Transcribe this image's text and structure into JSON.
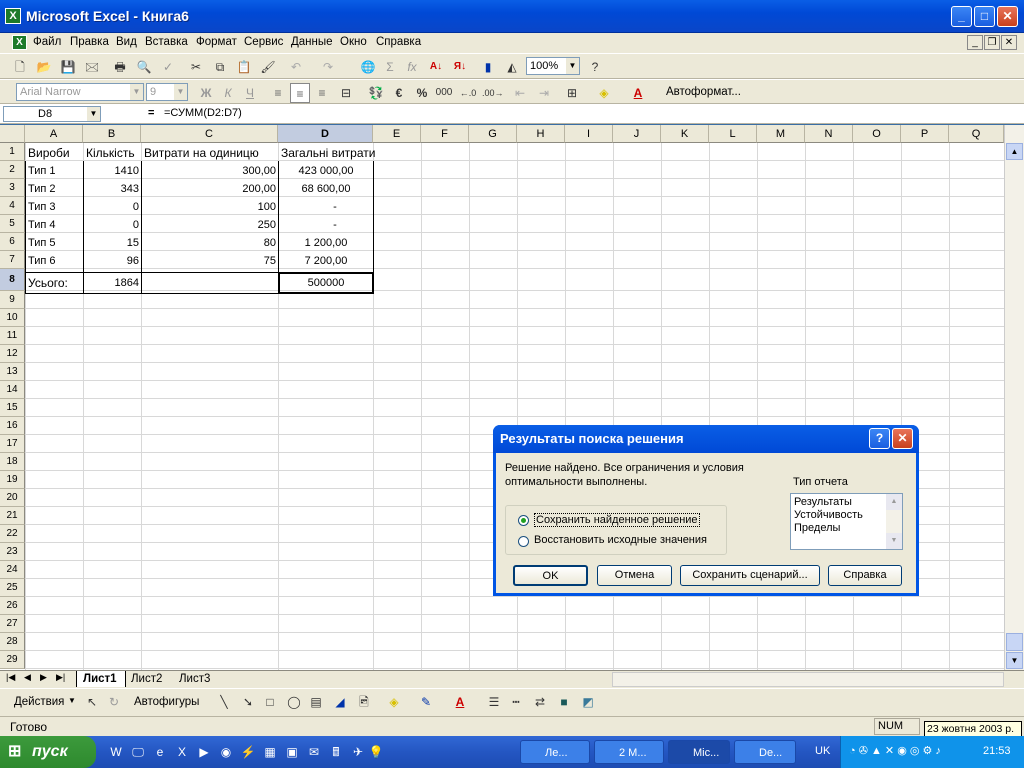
{
  "window": {
    "title": "Microsoft Excel - Книга6"
  },
  "menu": [
    "Файл",
    "Правка",
    "Вид",
    "Вставка",
    "Формат",
    "Сервис",
    "Данные",
    "Окно",
    "Справка"
  ],
  "toolbar": {
    "zoom": "100%",
    "font": "Arial Narrow",
    "size": "9",
    "bold": "Ж",
    "italic": "К",
    "underline": "Ч",
    "autoformat": "Автоформат...",
    "currency": "€",
    "percent": "%",
    "thousands": "000",
    "sigma": "Σ",
    "fx": "fx"
  },
  "formula": {
    "cell_ref": "D8",
    "eq": "=",
    "content": "=СУММ(D2:D7)"
  },
  "columns": [
    "A",
    "B",
    "C",
    "D",
    "E",
    "F",
    "G",
    "H",
    "I",
    "J",
    "K",
    "L",
    "M",
    "N",
    "O",
    "P",
    "Q"
  ],
  "rows": [
    "1",
    "2",
    "3",
    "4",
    "5",
    "6",
    "7",
    "8",
    "9",
    "10",
    "11",
    "12",
    "13",
    "14",
    "15",
    "16",
    "17",
    "18",
    "19",
    "20",
    "21",
    "22",
    "23",
    "24",
    "25",
    "26",
    "27",
    "28",
    "29"
  ],
  "table": {
    "headers": [
      "Вироби",
      "Кількість",
      "Витрати на одиницю",
      "Загальні витрати"
    ],
    "rows": [
      [
        "Тип 1",
        "1410",
        "300,00",
        "423 000,00"
      ],
      [
        "Тип 2",
        "343",
        "200,00",
        "68 600,00"
      ],
      [
        "Тип 3",
        "0",
        "100",
        "-"
      ],
      [
        "Тип 4",
        "0",
        "250",
        "-"
      ],
      [
        "Тип 5",
        "15",
        "80",
        "1 200,00"
      ],
      [
        "Тип 6",
        "96",
        "75",
        "7 200,00"
      ]
    ],
    "total": [
      "Усього:",
      "1864",
      "",
      "500000"
    ]
  },
  "sheets": [
    "Лист1",
    "Лист2",
    "Лист3"
  ],
  "drawing": {
    "actions": "Действия",
    "autoshapes": "Автофигуры"
  },
  "status": {
    "ready": "Готово",
    "num": "NUM",
    "tooltip": "23 жовтня 2003 р."
  },
  "dialog": {
    "title": "Результаты поиска решения",
    "message": "Решение найдено. Все ограничения и условия оптимальности выполнены.",
    "report_type_label": "Тип отчета",
    "reports": [
      "Результаты",
      "Устойчивость",
      "Пределы"
    ],
    "option_keep": "Сохранить найденное решение",
    "option_restore": "Восстановить исходные значения",
    "ok": "OK",
    "cancel": "Отмена",
    "save_scenario": "Сохранить сценарий...",
    "help": "Справка"
  },
  "taskbar": {
    "start": "пуск",
    "buttons": [
      "Ле...",
      "2 М...",
      "Mic...",
      "De..."
    ],
    "lang": "UK",
    "clock": "21:53"
  }
}
